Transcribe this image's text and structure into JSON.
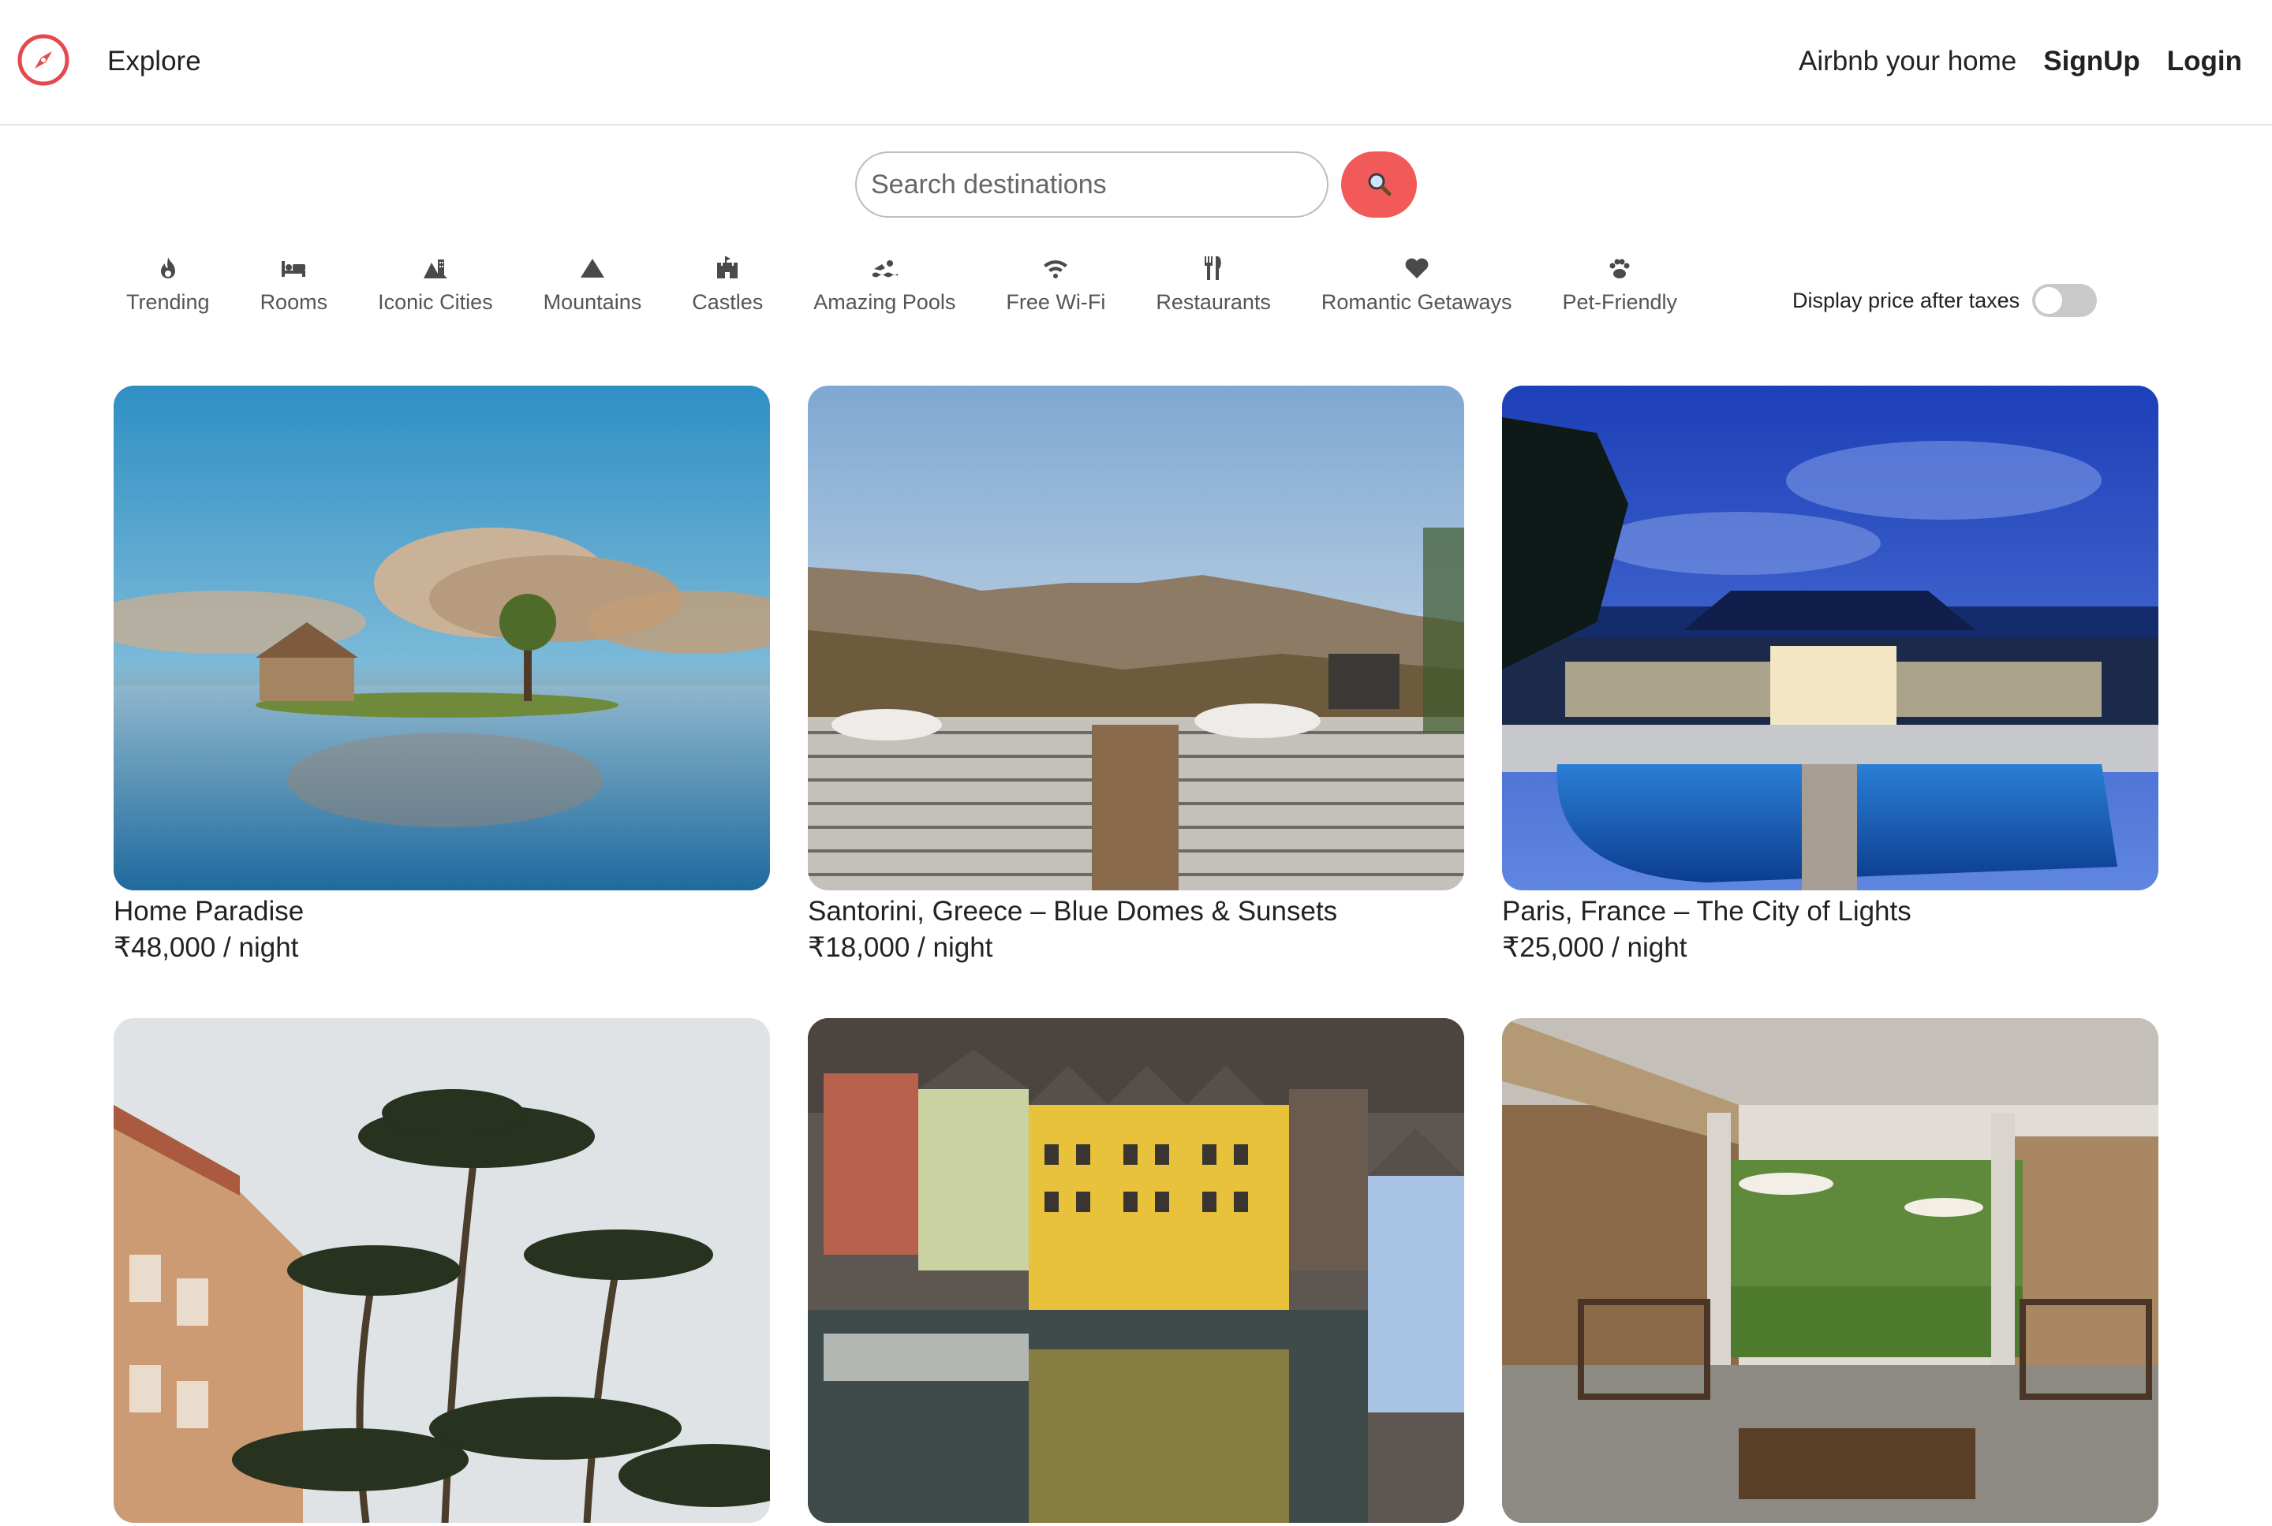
{
  "nav": {
    "explore": "Explore",
    "host": "Airbnb your home",
    "signup": "SignUp",
    "login": "Login",
    "brand_color": "#e5484d",
    "logo_icon": "compass-icon"
  },
  "search": {
    "placeholder": "Search destinations",
    "button_color": "#f25a5a",
    "button_icon": "search-icon"
  },
  "filters": [
    {
      "label": "Trending",
      "icon": "fire-icon"
    },
    {
      "label": "Rooms",
      "icon": "bed-icon"
    },
    {
      "label": "Iconic Cities",
      "icon": "city-icon"
    },
    {
      "label": "Mountains",
      "icon": "mountain-icon"
    },
    {
      "label": "Castles",
      "icon": "castle-icon"
    },
    {
      "label": "Amazing Pools",
      "icon": "swimmer-icon"
    },
    {
      "label": "Free Wi-Fi",
      "icon": "wifi-icon"
    },
    {
      "label": "Restaurants",
      "icon": "utensils-icon"
    },
    {
      "label": "Romantic Getaways",
      "icon": "heart-icon"
    },
    {
      "label": "Pet-Friendly",
      "icon": "paw-icon"
    }
  ],
  "tax_toggle": {
    "label": "Display price after taxes",
    "enabled": false
  },
  "listings": [
    {
      "title": "Home Paradise",
      "price": "₹48,000 / night"
    },
    {
      "title": "Santorini, Greece – Blue Domes & Sunsets",
      "price": "₹18,000 / night"
    },
    {
      "title": "Paris, France – The City of Lights",
      "price": "₹25,000 / night"
    },
    {
      "title": "",
      "price": ""
    },
    {
      "title": "",
      "price": ""
    },
    {
      "title": "",
      "price": ""
    }
  ]
}
